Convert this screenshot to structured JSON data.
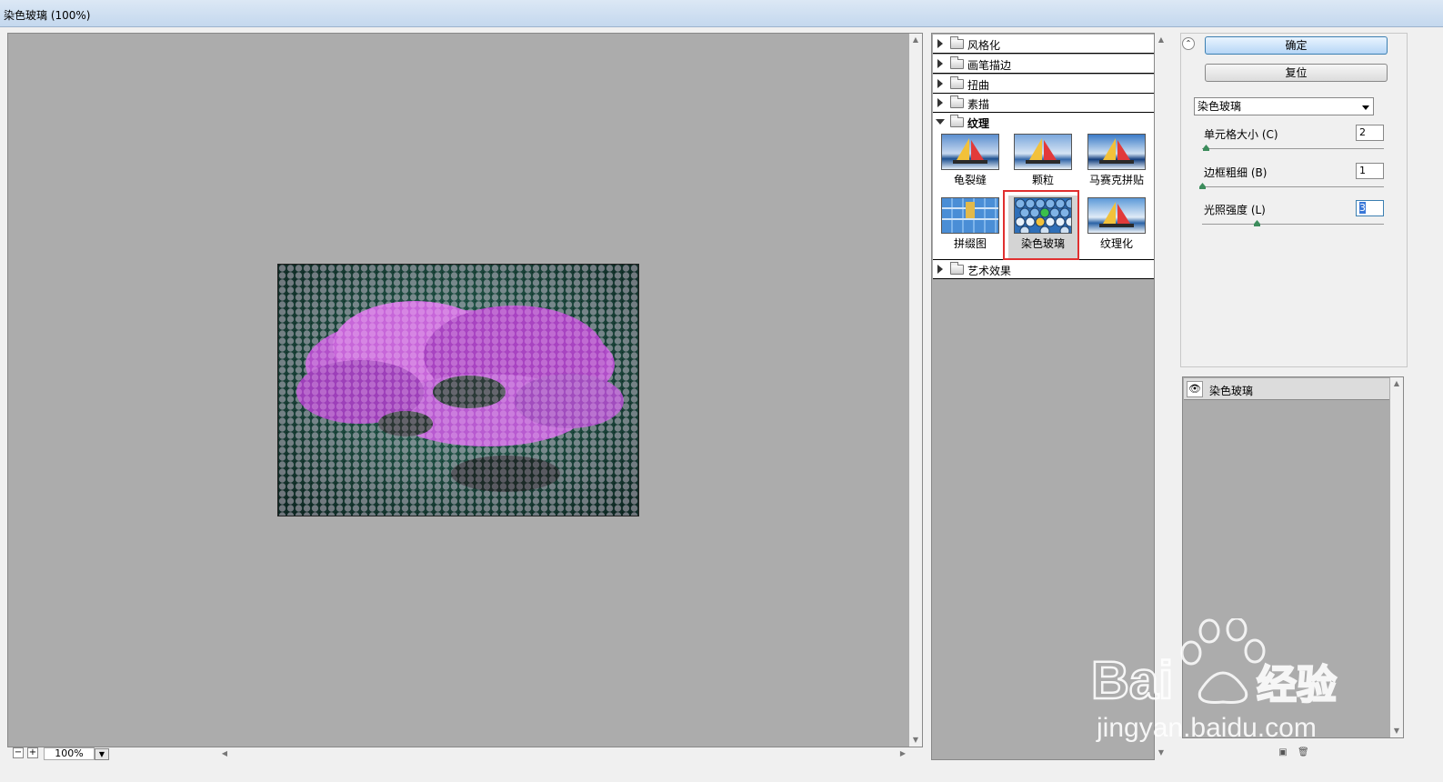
{
  "window": {
    "title": "染色玻璃 (100%)"
  },
  "preview": {
    "zoom": "100%"
  },
  "filter_categories": [
    {
      "label": "风格化",
      "expanded": false
    },
    {
      "label": "画笔描边",
      "expanded": false
    },
    {
      "label": "扭曲",
      "expanded": false
    },
    {
      "label": "素描",
      "expanded": false
    },
    {
      "label": "纹理",
      "expanded": true
    },
    {
      "label": "艺术效果",
      "expanded": false
    }
  ],
  "texture_filters": [
    "龟裂缝",
    "颗粒",
    "马赛克拼贴",
    "拼缀图",
    "染色玻璃",
    "纹理化"
  ],
  "selected_filter": "染色玻璃",
  "buttons": {
    "ok": "确定",
    "reset": "复位"
  },
  "settings": {
    "filter_select": "染色玻璃",
    "params": [
      {
        "label": "单元格大小 (C)",
        "value": "2",
        "slider_fraction": 0.02
      },
      {
        "label": "边框粗细 (B)",
        "value": "1",
        "slider_fraction": 0.0
      },
      {
        "label": "光照强度 (L)",
        "value": "3",
        "slider_fraction": 0.3
      }
    ]
  },
  "layers": [
    {
      "name": "染色玻璃",
      "visible": true
    }
  ],
  "watermark": {
    "brand": "Bai",
    "brand2": "经验",
    "url": "jingyan.baidu.com"
  },
  "colors": {
    "accent_highlight": "#e03030",
    "preview_bg": "#acacac",
    "ok_button": "#b6d6f6"
  }
}
